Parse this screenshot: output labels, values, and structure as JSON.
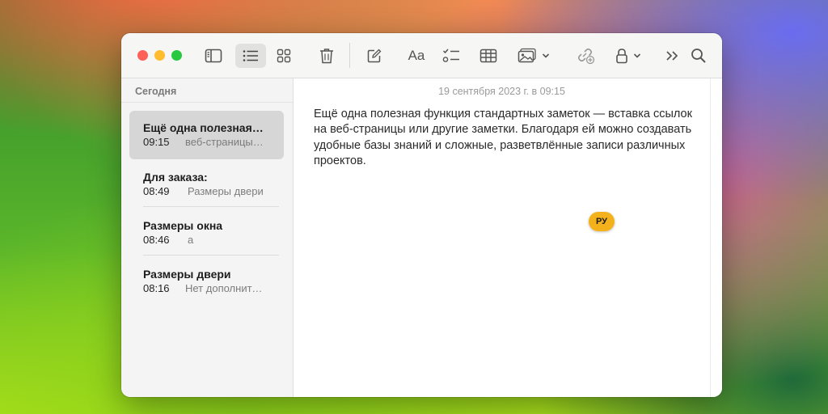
{
  "toolbar": {
    "buttons": [
      {
        "icon": "sidebar-toggle-icon",
        "label": "Show sidebar"
      },
      {
        "icon": "list-view-icon",
        "label": "List view",
        "active": true
      },
      {
        "icon": "gallery-view-icon",
        "label": "Gallery view"
      },
      {
        "icon": "trash-icon",
        "label": "Delete"
      },
      {
        "icon": "compose-icon",
        "label": "New note"
      },
      {
        "icon": "format-text-icon",
        "label": "Aa"
      },
      {
        "icon": "checklist-icon",
        "label": "Checklist"
      },
      {
        "icon": "table-icon",
        "label": "Table"
      },
      {
        "icon": "media-icon",
        "label": "Media"
      },
      {
        "icon": "collaborate-icon",
        "label": "Collaborate"
      },
      {
        "icon": "lock-icon",
        "label": "Lock"
      },
      {
        "icon": "more-chevrons-icon",
        "label": "More"
      },
      {
        "icon": "search-icon",
        "label": "Search"
      }
    ],
    "format_label": "Aa"
  },
  "sidebar": {
    "section": "Сегодня",
    "notes": [
      {
        "title": "Ещё одна полезная функция стандартных заметок",
        "time": "09:15",
        "preview": "веб-страницы или другие заметки",
        "selected": true
      },
      {
        "title": "Для заказа:",
        "time": "08:49",
        "preview": "Размеры двери",
        "selected": false
      },
      {
        "title": "Размеры окна",
        "time": "08:46",
        "preview": "a",
        "selected": false
      },
      {
        "title": "Размеры двери",
        "time": "08:16",
        "preview": "Нет дополнительного текста",
        "selected": false
      }
    ]
  },
  "editor": {
    "date": "19 сентября 2023 г. в 09:15",
    "body": "Ещё одна полезная функция стандартных заметок — вставка ссылок на веб-страницы или другие заметки. Благодаря ей можно создавать удобные базы знаний и сложные, разветвлённые записи различных проектов.",
    "language_badge": "РУ"
  },
  "colors": {
    "close": "#fe5f57",
    "minimize": "#febc2e",
    "zoom": "#28c840",
    "badge": "#f3b21c",
    "selection": "#d6d6d6"
  }
}
